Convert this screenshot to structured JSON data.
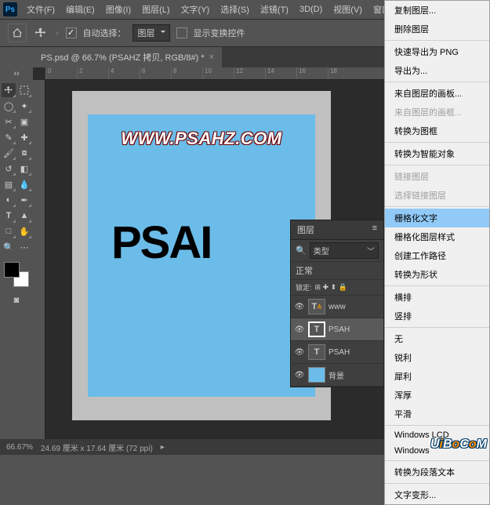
{
  "menubar": [
    "文件(F)",
    "编辑(E)",
    "图像(I)",
    "图层(L)",
    "文字(Y)",
    "选择(S)",
    "滤镜(T)",
    "3D(D)",
    "视图(V)",
    "窗口"
  ],
  "optbar": {
    "auto_select": "自动选择：",
    "auto_select_target": "图层",
    "show_transform": "显示变换控件"
  },
  "tab": {
    "title": "PS.psd @ 66.7% (PSAHZ 拷贝, RGB/8#) *"
  },
  "ruler_ticks": [
    "0",
    "2",
    "4",
    "6",
    "8",
    "10",
    "12",
    "14",
    "16",
    "18"
  ],
  "canvas": {
    "watermark": "WWW.PSAHZ.COM",
    "big_text": "PSAI"
  },
  "layers": {
    "panel_title": "图层",
    "type_label": "类型",
    "blend_mode": "正常",
    "lock_label": "锁定:",
    "rows": [
      {
        "name": "www"
      },
      {
        "name": "PSAH"
      },
      {
        "name": "PSAH"
      },
      {
        "name": "背景"
      }
    ]
  },
  "menu": {
    "items": [
      {
        "t": "复制图层...",
        "k": "item"
      },
      {
        "t": "删除图层",
        "k": "item"
      },
      {
        "k": "sep"
      },
      {
        "t": "快速导出为 PNG",
        "k": "item"
      },
      {
        "t": "导出为...",
        "k": "item"
      },
      {
        "k": "sep"
      },
      {
        "t": "来自图层的画板...",
        "k": "item"
      },
      {
        "t": "来自图层的画框...",
        "k": "dis"
      },
      {
        "t": "转换为图框",
        "k": "item"
      },
      {
        "k": "sep"
      },
      {
        "t": "转换为智能对象",
        "k": "item"
      },
      {
        "k": "sep"
      },
      {
        "t": "链接图层",
        "k": "dis"
      },
      {
        "t": "选择链接图层",
        "k": "dis"
      },
      {
        "k": "sep"
      },
      {
        "t": "栅格化文字",
        "k": "hl"
      },
      {
        "t": "栅格化图层样式",
        "k": "item"
      },
      {
        "t": "创建工作路径",
        "k": "item"
      },
      {
        "t": "转换为形状",
        "k": "item"
      },
      {
        "k": "sep"
      },
      {
        "t": "横排",
        "k": "item"
      },
      {
        "t": "竖排",
        "k": "item"
      },
      {
        "k": "sep"
      },
      {
        "t": "无",
        "k": "item"
      },
      {
        "t": "锐利",
        "k": "item"
      },
      {
        "t": "犀利",
        "k": "item"
      },
      {
        "t": "浑厚",
        "k": "item"
      },
      {
        "t": "平滑",
        "k": "item"
      },
      {
        "k": "sep"
      },
      {
        "t": "Windows LCD",
        "k": "item"
      },
      {
        "t": "Windows",
        "k": "item"
      },
      {
        "k": "sep"
      },
      {
        "t": "转换为段落文本",
        "k": "item"
      },
      {
        "k": "sep"
      },
      {
        "t": "文字变形...",
        "k": "item"
      }
    ]
  },
  "status": {
    "zoom": "66.67%",
    "doc": "24.69 厘米 x 17.64 厘米 (72 ppi)"
  },
  "search_icon": "🔍",
  "watermark_brand": {
    "u": "U",
    "i": "i",
    "b": "B",
    "o1": "o",
    ".": ".",
    "c": "C",
    "o2": "o",
    "m": "M"
  }
}
